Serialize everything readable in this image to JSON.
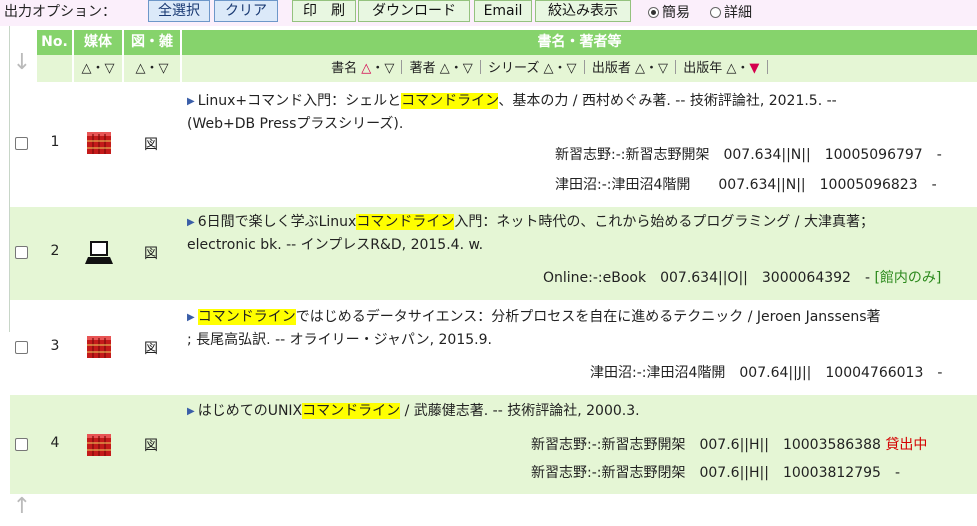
{
  "options": {
    "label": "出力オプション：",
    "select_all": "全選択",
    "clear": "クリア",
    "print": "印　刷",
    "download": "ダウンロード",
    "email": "Email",
    "filter": "絞込み表示",
    "radio_simple": "簡易",
    "radio_detail": "詳細"
  },
  "header": {
    "no": "No.",
    "media": "媒体",
    "zu": "図・雑",
    "title_author": "書名・著者等",
    "sort": "△・▽",
    "sort_title": "書名",
    "sort_author": "著者",
    "sort_series": "シリーズ",
    "sort_publisher": "出版者",
    "sort_year": "出版年",
    "sort_up": "△",
    "sort_down": "▽",
    "sort_down_active": "▼",
    "dot": "・"
  },
  "arrows": {
    "up": "↑",
    "down": "↓"
  },
  "records": [
    {
      "no": "1",
      "media": "book-icon",
      "zu": "図",
      "t1_pre": "Linux+コマンド入門：シェルと",
      "t1_hl": "コマンドライン",
      "t1_post": "、基本の力 / 西村めぐみ著. -- 技術評論社, 2021.5. --",
      "t2": "(Web+DB Pressプラスシリーズ).",
      "holdings": [
        {
          "text": "新習志野:-:新習志野開架　007.634||N||　10005096797　-"
        },
        {
          "text": "津田沼:-:津田沼4階開　　007.634||N||　10005096823　-"
        }
      ]
    },
    {
      "no": "2",
      "media": "pc-icon",
      "zu": "図",
      "t1_pre": "6日間で楽しく学ぶLinux",
      "t1_hl": "コマンドライン",
      "t1_post": "入門：ネット時代の、これから始めるプログラミング / 大津真著；",
      "t2": "electronic bk. -- インプレスR&D, 2015.4. w.",
      "holdings": [
        {
          "text": "Online:-:eBook　007.634||O||　3000064392　-",
          "note": "[館内のみ]"
        }
      ]
    },
    {
      "no": "3",
      "media": "book-icon",
      "zu": "図",
      "t1_pre": "",
      "t1_hl": "コマンドライン",
      "t1_post": "ではじめるデータサイエンス：分析プロセスを自在に進めるテクニック / Jeroen Janssens著",
      "t2": "; 長尾高弘訳. -- オライリー・ジャパン, 2015.9.",
      "holdings": [
        {
          "text": "津田沼:-:津田沼4階開　007.64||J||　10004766013　-"
        }
      ]
    },
    {
      "no": "4",
      "media": "book-icon",
      "zu": "図",
      "t1_pre": "はじめてのUNIX",
      "t1_hl": "コマンドライン",
      "t1_post": " / 武藤健志著. -- 技術評論社, 2000.3.",
      "t2": "",
      "holdings": [
        {
          "text": "新習志野:-:新習志野開架　007.6||H||　10003586388",
          "status": "貸出中"
        },
        {
          "text": "新習志野:-:新習志野閉架　007.6||H||　10003812795　-"
        }
      ]
    }
  ],
  "colors": {
    "header_green": "#86d36c",
    "row_alt": "#e5f6d5",
    "highlight": "#ffff00"
  }
}
